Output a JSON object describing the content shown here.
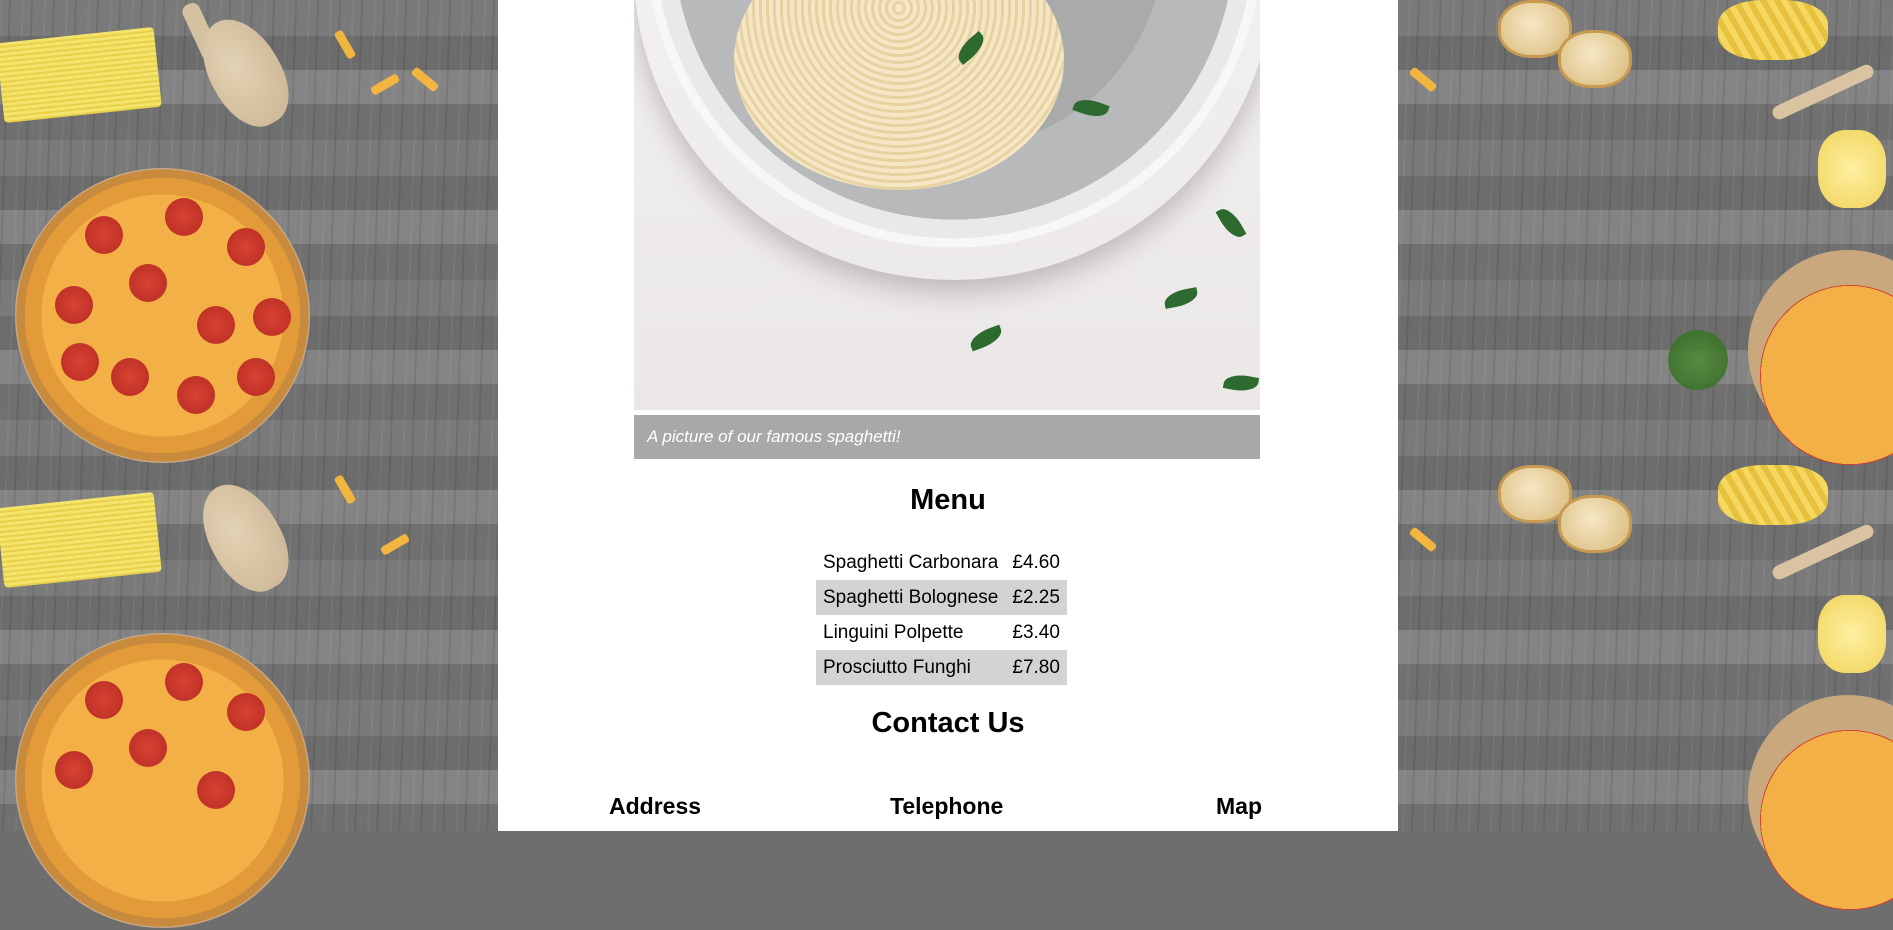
{
  "hero": {
    "caption": "A picture of our famous spaghetti!"
  },
  "menu": {
    "title": "Menu",
    "items": [
      {
        "name": "Spaghetti Carbonara",
        "price": "£4.60"
      },
      {
        "name": "Spaghetti Bolognese",
        "price": "£2.25"
      },
      {
        "name": "Linguini Polpette",
        "price": "£3.40"
      },
      {
        "name": "Prosciutto Funghi",
        "price": "£7.80"
      }
    ]
  },
  "contact": {
    "title": "Contact Us",
    "columns": [
      "Address",
      "Telephone",
      "Map"
    ]
  },
  "colors": {
    "caption_bg": "#a8a8a8",
    "row_highlight": "#d3d3d3",
    "panel_bg": "#ffffff"
  }
}
